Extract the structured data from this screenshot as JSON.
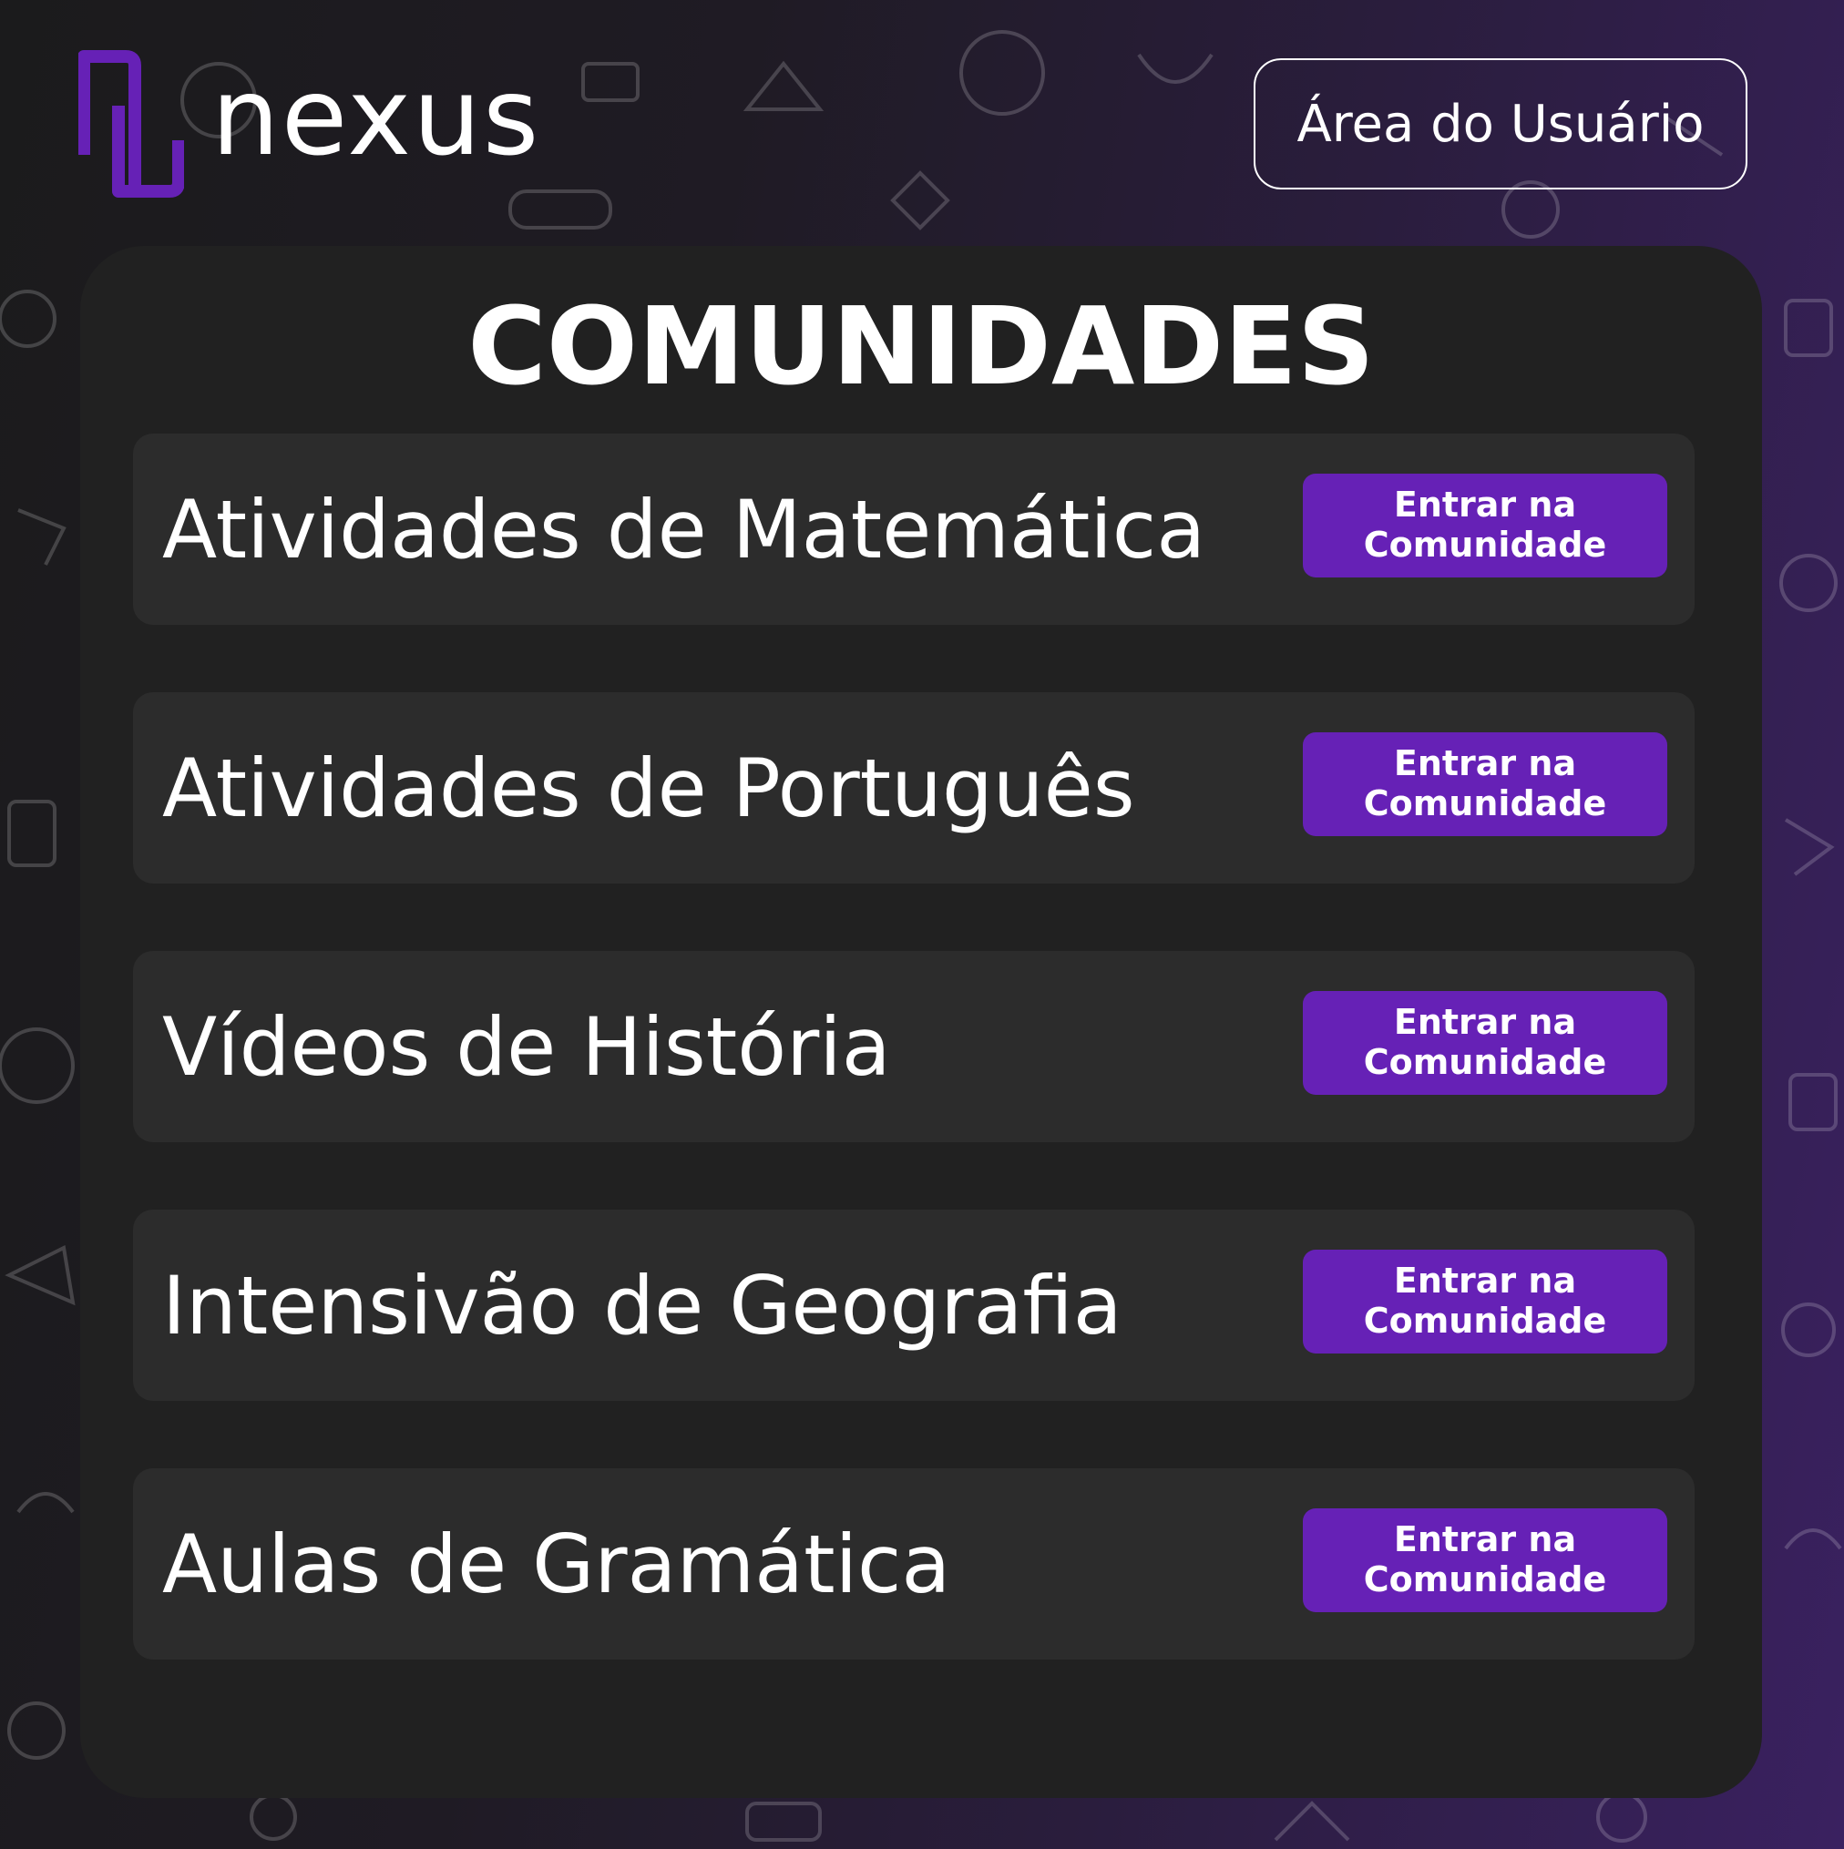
{
  "brand": {
    "name": "nexus",
    "logo_icon": "nexus-logo-mark",
    "accent_color": "#6621b6"
  },
  "header": {
    "user_area_label": "Área do Usuário"
  },
  "page": {
    "title": "COMUNIDADES"
  },
  "communities": [
    {
      "name": "Atividades de Matemática",
      "button_line1": "Entrar na",
      "button_line2": "Comunidade"
    },
    {
      "name": "Atividades de Português",
      "button_line1": "Entrar na",
      "button_line2": "Comunidade"
    },
    {
      "name": "Vídeos de História",
      "button_line1": "Entrar na",
      "button_line2": "Comunidade"
    },
    {
      "name": "Intensivão de Geografia",
      "button_line1": "Entrar na",
      "button_line2": "Comunidade"
    },
    {
      "name": "Aulas de Gramática",
      "button_line1": "Entrar na",
      "button_line2": "Comunidade"
    }
  ]
}
